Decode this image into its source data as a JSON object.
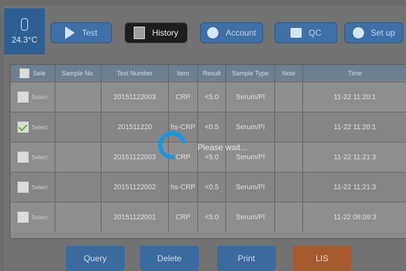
{
  "status": {
    "temperature": "24.3°C"
  },
  "toolbar": {
    "test_label": "Test",
    "history_label": "History",
    "account_label": "Account",
    "qc_label": "QC",
    "setup_label": "Set up"
  },
  "table": {
    "columns": [
      "Sele",
      "Sample No.",
      "Test Number",
      "Item",
      "Result",
      "Sample Type",
      "Note",
      "Time"
    ],
    "rows": [
      {
        "select_label": "Select",
        "checked": false,
        "sample_no": "",
        "test_number": "20151122003",
        "item": "CRP",
        "result": "<5.0",
        "sample_type": "Serum/Pl",
        "note": "",
        "time": "11-22 11:20:1"
      },
      {
        "select_label": "Select",
        "checked": true,
        "sample_no": "",
        "test_number": "201511220",
        "item": "hs-CRP",
        "result": "<0.5",
        "sample_type": "Serum/Pl",
        "note": "",
        "time": "11-22 11:20:1"
      },
      {
        "select_label": "Select",
        "checked": false,
        "sample_no": "",
        "test_number": "20151122003",
        "item": "CRP",
        "result": "<5.0",
        "sample_type": "Serum/Pl",
        "note": "",
        "time": "11-22 11:21:3"
      },
      {
        "select_label": "Select",
        "checked": false,
        "sample_no": "",
        "test_number": "20151122002",
        "item": "hs-CRP",
        "result": "<0.5",
        "sample_type": "Serum/Pl",
        "note": "",
        "time": "11-22 11:21:3"
      },
      {
        "select_label": "Select",
        "checked": false,
        "sample_no": "",
        "test_number": "20151122001",
        "item": "CRP",
        "result": "<5.0",
        "sample_type": "Serum/Pl",
        "note": "",
        "time": "11-22 08:09:3"
      }
    ]
  },
  "overlay": {
    "wait_text": "Please wait..."
  },
  "actions": {
    "query_label": "Query",
    "delete_label": "Delete",
    "print_label": "Print",
    "lis_label": "LIS"
  },
  "colors": {
    "button_blue": "#3e6fa7",
    "button_active": "#1d1d1d",
    "spinner_blue": "#1a95e2",
    "lis_orange": "#a55a2f"
  }
}
